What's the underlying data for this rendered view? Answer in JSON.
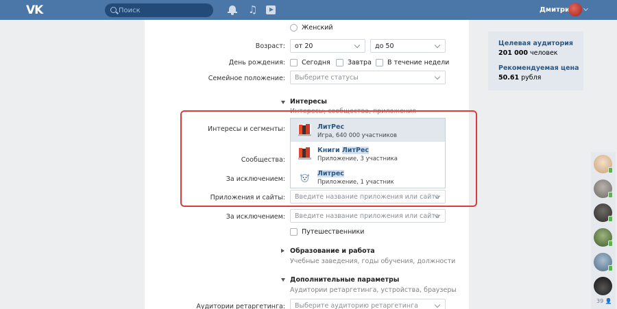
{
  "topbar": {
    "logo": "VK",
    "search_placeholder": "Поиск",
    "user_name": "Дмитрий"
  },
  "form": {
    "gender_female": "Женский",
    "age": {
      "label": "Возраст:",
      "from": "от 20",
      "to": "до 50"
    },
    "birthday": {
      "label": "День рождения:",
      "options": [
        "Сегодня",
        "Завтра",
        "В течение недели"
      ]
    },
    "family": {
      "label": "Семейное положение:",
      "placeholder": "Выберите статусы"
    },
    "interests": {
      "title": "Интересы",
      "subtitle": "Интересы, сообщества, приложения",
      "label_segments": "Интересы и сегменты:",
      "label_communities": "Сообщества:",
      "label_exclusion": "За исключением:",
      "label_apps": "Приложения и сайты:",
      "apps_placeholder": "Введите название приложения или сайта",
      "label_exclusion2": "За исключением:",
      "exclusion2_placeholder": "Введите название приложения или сайта",
      "travelers": "Путешественники"
    },
    "education": {
      "title": "Образование и работа",
      "subtitle": "Учебные заведения, годы обучения, должности"
    },
    "extra": {
      "title": "Дополнительные параметры",
      "subtitle": "Аудитории ретаргетинга, устройства, браузеры",
      "retarget_label": "Аудитории ретаргетинга:",
      "retarget_placeholder": "Выберите аудиторию ретаргетинга"
    }
  },
  "dropdown": {
    "items": [
      {
        "name": "ЛитРес",
        "desc": "Игра, 640 000 участников",
        "icon": "litres-book-icon"
      },
      {
        "name_pre": "Книги ",
        "name_hl": "ЛитРес",
        "desc": "Приложение, 3 участника",
        "icon": "litres-book-icon"
      },
      {
        "name": "Литрес",
        "desc": "Приложение, 1 участник",
        "icon": "dog-icon"
      }
    ]
  },
  "sidebar": {
    "audience_title": "Целевая аудитория",
    "audience_value": "201 000",
    "audience_unit": "человек",
    "price_title": "Рекомендуемая цена",
    "price_value": "50.61",
    "price_unit": "рубля"
  },
  "online_count": "39",
  "colors": {
    "header": "#4a76a8",
    "link": "#2a5885",
    "highlight_border": "#e0393a",
    "online": "#5fb053"
  }
}
